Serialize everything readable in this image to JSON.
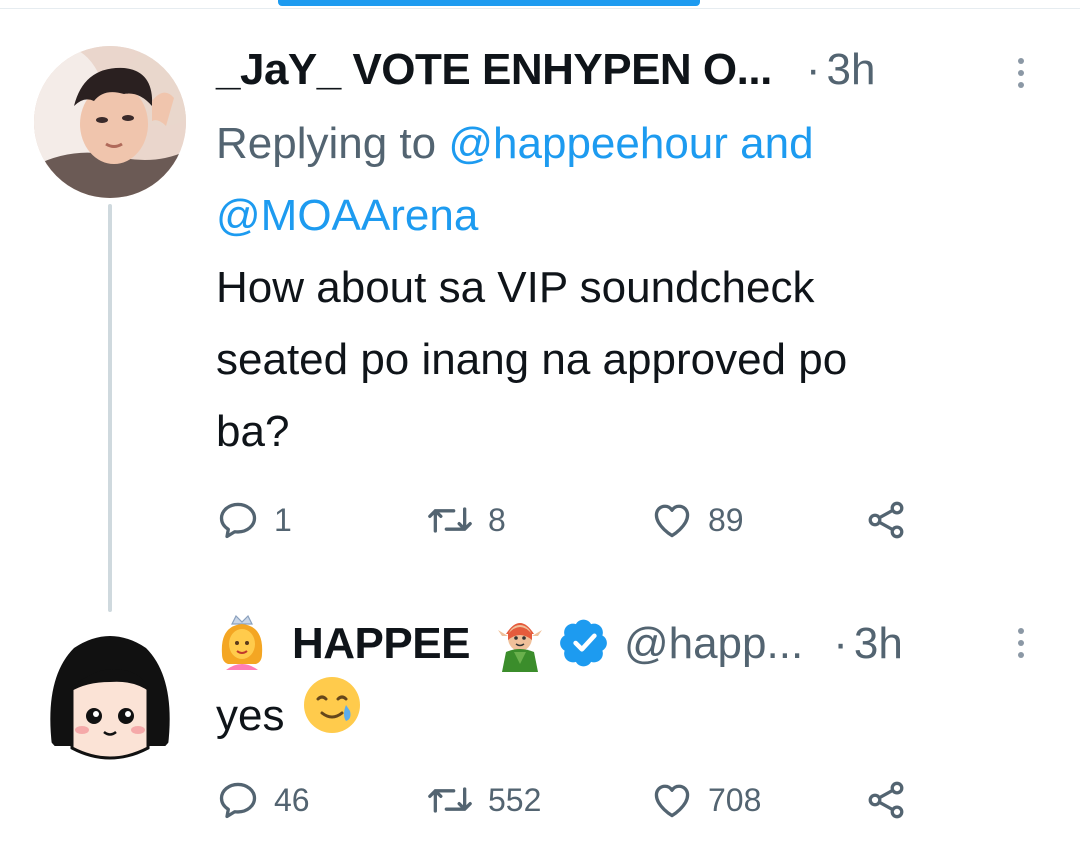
{
  "tweets": [
    {
      "display_name": "_JaY_ VOTE ENHYPEN O...",
      "separator": "·",
      "time": "3h",
      "replying_prefix": "Replying to",
      "reply_mention_1": "@happeehour",
      "reply_and": "and",
      "reply_mention_2": "@MOAArena",
      "text_lines": [
        "How about sa VIP soundcheck",
        "seated po inang na approved po",
        "ba?"
      ],
      "replies": "1",
      "retweets": "8",
      "likes": "89"
    },
    {
      "display_name": "HAPPEE",
      "handle": "@happ...",
      "separator": "·",
      "time": "3h",
      "text": "yes",
      "verified": true,
      "replies": "46",
      "retweets": "552",
      "likes": "708"
    }
  ],
  "icons": {
    "reply": "reply-icon",
    "retweet": "retweet-icon",
    "like": "heart-icon",
    "share": "share-icon",
    "verified": "verified-badge-icon",
    "emoji_princess": "princess-emoji",
    "emoji_elf": "elf-emoji",
    "emoji_smile_tear": "smiling-face-with-tear-emoji"
  },
  "colors": {
    "accent": "#1d9bf0",
    "text": "#0f1419",
    "secondary": "#536471",
    "thread_line": "#cfd9de"
  }
}
